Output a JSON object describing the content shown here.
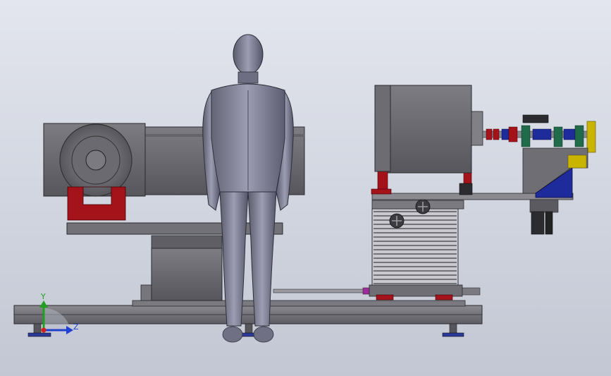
{
  "viewport": {
    "background_top": "#e3e6ee",
    "background_bottom": "#c2c7d3"
  },
  "triad": {
    "y_label": "Y",
    "z_label": "Z",
    "y_color": "#1fa01f",
    "z_color": "#2040d0",
    "x_color": "#d02020"
  },
  "palette": {
    "steel": "#6e6e74",
    "steel_dark": "#3a3a40",
    "steel_light": "#9a9aa2",
    "red_parts": "#a4121a",
    "blue_parts": "#1e2b9a",
    "green_parts": "#1f6b4a",
    "yellow_parts": "#c9b400",
    "mannequin": "#7f8096"
  }
}
